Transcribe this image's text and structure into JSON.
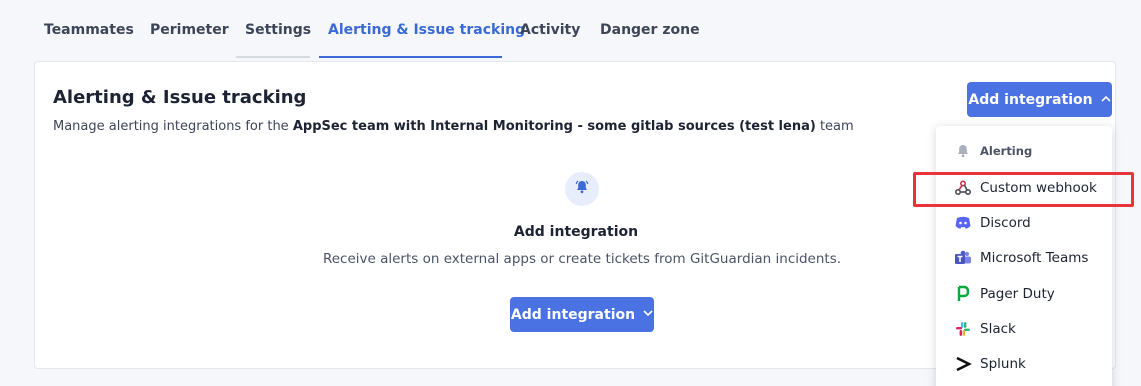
{
  "tabs": [
    {
      "label": "Teammates",
      "active": false
    },
    {
      "label": "Perimeter",
      "active": false
    },
    {
      "label": "Settings",
      "active": false
    },
    {
      "label": "Alerting & Issue tracking",
      "active": true
    },
    {
      "label": "Activity",
      "active": false
    },
    {
      "label": "Danger zone",
      "active": false
    }
  ],
  "card": {
    "title": "Alerting & Issue tracking",
    "desc_prefix": "Manage alerting integrations for the",
    "team_name": "AppSec team with Internal Monitoring - some gitlab sources (test lena)",
    "desc_suffix": "team",
    "header_button": "Add integration",
    "empty_title": "Add integration",
    "empty_desc": "Receive alerts on external apps or create tickets from GitGuardian incidents.",
    "empty_button": "Add integration"
  },
  "dropdown": {
    "header": {
      "label": "Alerting",
      "icon": "bell-icon"
    },
    "items": [
      {
        "label": "Custom webhook",
        "icon": "webhook-icon"
      },
      {
        "label": "Discord",
        "icon": "discord-icon"
      },
      {
        "label": "Microsoft Teams",
        "icon": "microsoft-teams-icon"
      },
      {
        "label": "Pager Duty",
        "icon": "pagerduty-icon"
      },
      {
        "label": "Slack",
        "icon": "slack-icon"
      },
      {
        "label": "Splunk",
        "icon": "splunk-icon"
      }
    ]
  },
  "colors": {
    "accent": "#4a72e2",
    "active_tab": "#3b6ad6",
    "highlight": "#e8323c"
  }
}
